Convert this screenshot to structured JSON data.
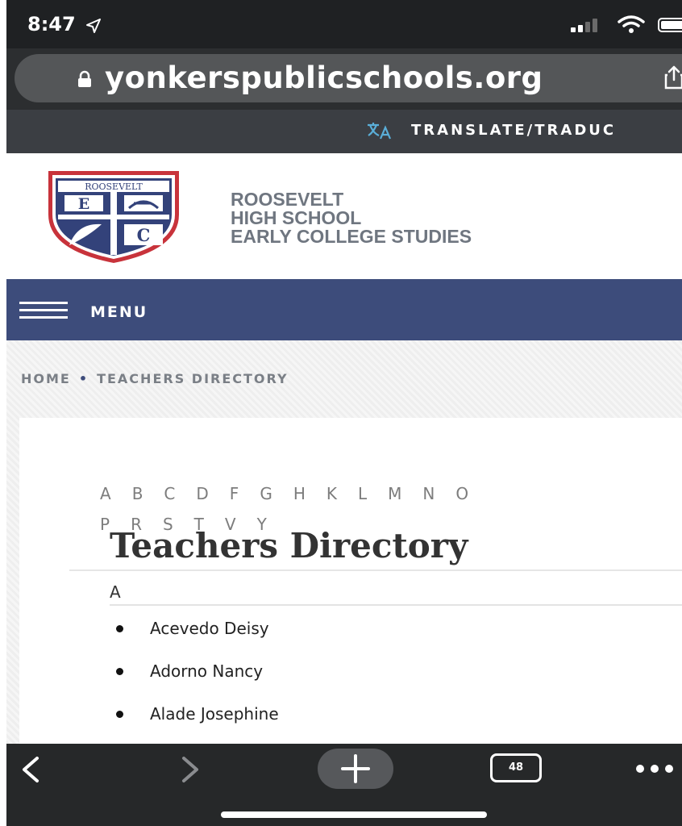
{
  "status_bar": {
    "time": "8:47"
  },
  "browser": {
    "url": "yonkerspublicschools.org",
    "tab_count": "48"
  },
  "translate": {
    "label": "TRANSLATE/TRADUC"
  },
  "school": {
    "crest_text": "ROOSEVELT",
    "name_line1": "ROOSEVELT",
    "name_line2": "HIGH SCHOOL",
    "name_line3": "EARLY COLLEGE STUDIES"
  },
  "menu": {
    "label": "MENU"
  },
  "breadcrumb": {
    "home": "HOME",
    "separator": "•",
    "current": "TEACHERS DIRECTORY"
  },
  "alphabet": {
    "row1": [
      "A",
      "B",
      "C",
      "D",
      "F",
      "G",
      "H",
      "K",
      "L",
      "M",
      "N",
      "O"
    ],
    "row2": [
      "P",
      "R",
      "S",
      "T",
      "V",
      "Y"
    ]
  },
  "directory": {
    "title": "Teachers Directory",
    "section_letter": "A",
    "teachers": [
      "Acevedo Deisy",
      "Adorno Nancy",
      "Alade Josephine"
    ]
  },
  "colors": {
    "menu_bar": "#3d4c7b",
    "browser_chrome": "#2c2e30",
    "translate_bar": "#3b3e43",
    "school_name": "#6f7680"
  }
}
